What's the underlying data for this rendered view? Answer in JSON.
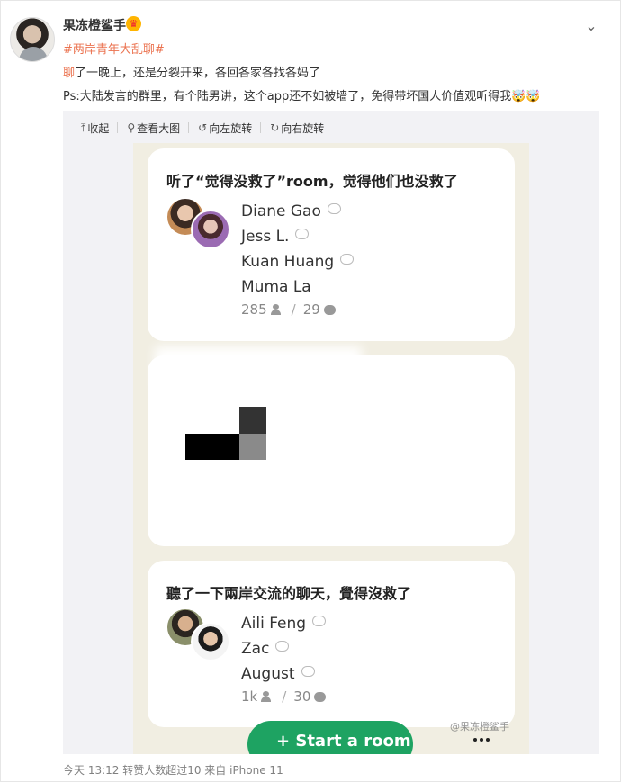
{
  "post": {
    "username": "果冻橙鲨手",
    "topic": "#两岸青年大乱聊#",
    "line1_highlight": "聊",
    "line1_rest": "了一晚上，还是分裂开来，各回各家各找各妈了",
    "line2": "Ps:大陆发言的群里，有个陆男讲，这个app还不如被墙了，免得带坏国人价值观听得我🤯🤯",
    "footer": "今天 13:12 转赞人数超过10  来自 iPhone 11"
  },
  "toolbar": {
    "collapse_label": "收起",
    "view_large_label": "查看大图",
    "rotate_left_label": "向左旋转",
    "rotate_right_label": "向右旋转"
  },
  "rooms": [
    {
      "title": "听了“觉得没救了”room，觉得他们也没救了",
      "speakers": [
        "Diane Gao",
        "Jess L.",
        "Kuan Huang",
        "Muma La"
      ],
      "listeners": "285",
      "speaking": "29"
    },
    {
      "title": "聽了一下兩岸交流的聊天，覺得沒救了",
      "speakers": [
        "Aili Feng",
        "Zac",
        "August"
      ],
      "listeners": "1k",
      "speaking": "30"
    }
  ],
  "start_button": "+ Start a room",
  "watermark": "@果冻橙鲨手",
  "icons": {
    "more": "chevron-down-icon",
    "crown": "crown-icon"
  },
  "colors": {
    "accent": "#eb7350",
    "clubhouse_bg": "#f1eee2",
    "start_green": "#1ea362"
  }
}
